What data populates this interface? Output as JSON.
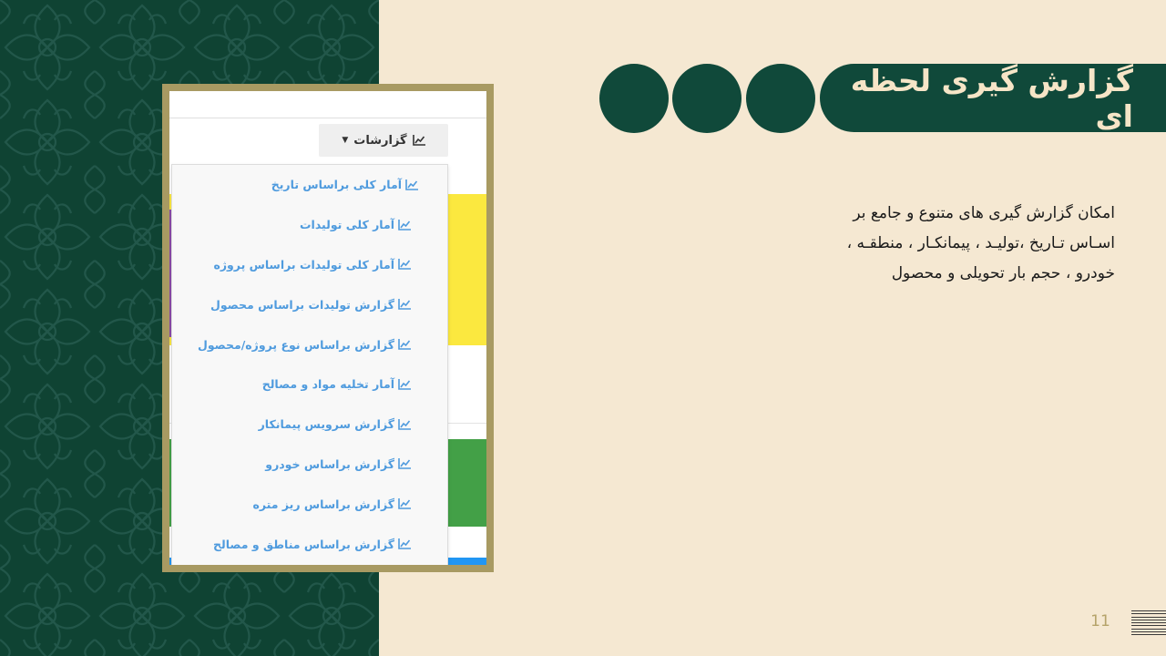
{
  "slide": {
    "title": "گزارش گیری لحظه ای",
    "description": [
      "امکان گزارش گیری های متنوع و جامع   بر",
      "اسـاس تـاریخ ،تولیـد ، پیمانکـار ، منطقـه ،",
      "خودرو ، حجم بار تحویلی و محصول"
    ],
    "page_number": "11"
  },
  "screenshot": {
    "reports_button": "گزارشات",
    "menu_items": [
      "آمار کلی براساس تاریخ",
      "آمار کلی تولیدات",
      "آمار کلی تولیدات براساس پروژه",
      "گزارش تولیدات براساس محصول",
      "گزارش براساس نوع پروژه/محصول",
      "آمار تخلیه مواد و مصالح",
      "گزارش سرویس پیمانکار",
      "گزارش براساس خودرو",
      "گزارش براساس ریز متره",
      "گزارش براساس مناطق و مصالح"
    ],
    "icon": "chart-line-icon"
  },
  "colors": {
    "background": "#f5e8d2",
    "dark_green": "#10493a",
    "frame_gold": "#a89a62",
    "link_blue": "#4f9bde",
    "title_text": "#f6e5c7"
  }
}
